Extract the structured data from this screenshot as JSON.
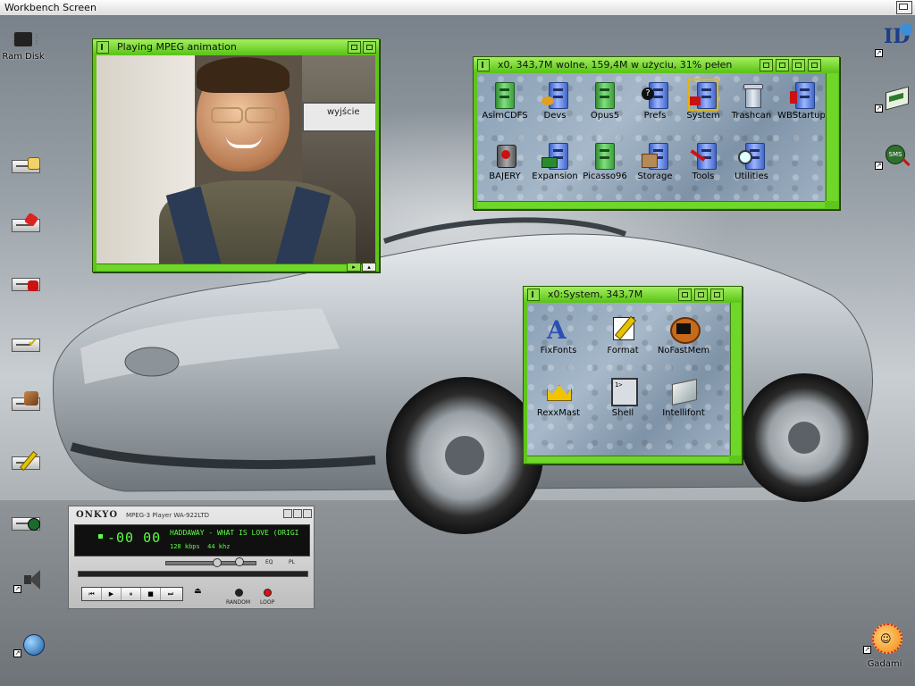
{
  "screen": {
    "title": "Workbench Screen"
  },
  "desktop_icons": {
    "left": [
      {
        "label": "Ram Disk",
        "icon": "chip-icon"
      },
      {
        "label": "",
        "icon": "drive-icon"
      },
      {
        "label": "",
        "icon": "drive-red-icon"
      },
      {
        "label": "",
        "icon": "drive-red-icon"
      },
      {
        "label": "",
        "icon": "drive-check-icon"
      },
      {
        "label": "",
        "icon": "drive-image-icon"
      },
      {
        "label": "",
        "icon": "drive-pencil-icon"
      },
      {
        "label": "",
        "icon": "drive-green-icon"
      },
      {
        "label": "",
        "icon": "speaker-icon"
      },
      {
        "label": "",
        "icon": "globe-icon"
      }
    ],
    "right": [
      {
        "label": "",
        "icon": "id-icon"
      },
      {
        "label": "",
        "icon": "terminal-icon"
      },
      {
        "label": "",
        "icon": "sms-icon"
      },
      {
        "label": "Gadami",
        "icon": "sun-icon"
      }
    ]
  },
  "mpeg_window": {
    "title": "Playing MPEG animation",
    "sign_text": "wyjście"
  },
  "drawer_window": {
    "title": "x0,  343,7M wolne, 159,4M w użyciu, 31% pełen",
    "icons": [
      {
        "label": "AsimCDFS",
        "icon": "drawer-green-icon"
      },
      {
        "label": "Devs",
        "icon": "drawer-blue-icon"
      },
      {
        "label": "Opus5",
        "icon": "drawer-green-icon"
      },
      {
        "label": "Prefs",
        "icon": "drawer-blue-icon"
      },
      {
        "label": "System",
        "icon": "drawer-blue-icon"
      },
      {
        "label": "Trashcan",
        "icon": "trashcan-icon"
      },
      {
        "label": "WBStartup",
        "icon": "drawer-blue-icon"
      },
      {
        "label": "BAJERY",
        "icon": "drawer-red-icon"
      },
      {
        "label": "Expansion",
        "icon": "drawer-blue-icon"
      },
      {
        "label": "Picasso96",
        "icon": "drawer-green-icon"
      },
      {
        "label": "Storage",
        "icon": "drawer-blue-icon"
      },
      {
        "label": "Tools",
        "icon": "drawer-blue-icon"
      },
      {
        "label": "Utilities",
        "icon": "drawer-blue-icon"
      }
    ]
  },
  "system_window": {
    "title": "x0:System,  343,7M",
    "icons": [
      {
        "label": "FixFonts",
        "icon": "fixfonts-icon"
      },
      {
        "label": "Format",
        "icon": "format-icon"
      },
      {
        "label": "NoFastMem",
        "icon": "chip-icon"
      },
      {
        "label": "RexxMast",
        "icon": "crown-icon"
      },
      {
        "label": "Shell",
        "icon": "shell-icon"
      },
      {
        "label": "Intellifont",
        "icon": "intellifont-icon"
      }
    ]
  },
  "player": {
    "brand": "ONKYO",
    "model": "MPEG-3 Player  WA-922LTD",
    "time": "-00 00",
    "song": "HADDAWAY - WHAT IS LOVE (ORIGI",
    "bitrate": "128 kbps",
    "freq": "44 khz",
    "eq_label": "EQ",
    "pl_label": "PL",
    "random_label": "RANDOM",
    "loop_label": "LOOP",
    "colors": {
      "lcd_text": "#5bff44"
    }
  },
  "colors": {
    "window_frame": "#5fc51c",
    "window_title": "#a3f05e"
  }
}
